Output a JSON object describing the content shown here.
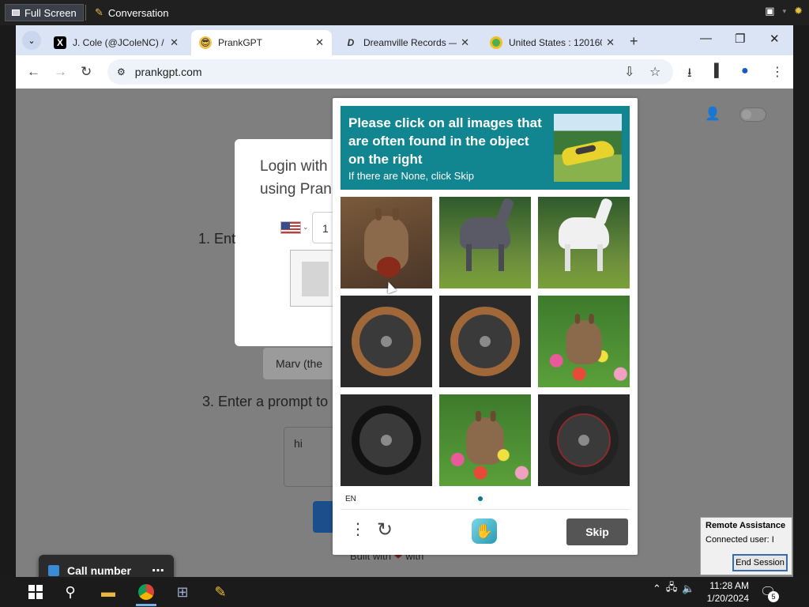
{
  "outer_bar": {
    "full_screen_label": "Full Screen",
    "conversation_label": "Conversation"
  },
  "tabs": [
    {
      "title": "J. Cole (@JColeNC) / X",
      "favicon": "x-logo-icon"
    },
    {
      "title": "PrankGPT",
      "favicon": "sunglasses-emoji-icon",
      "active": true
    },
    {
      "title": "Dreamville Records —",
      "favicon": "dreamville-icon"
    },
    {
      "title": "United States : 120160",
      "favicon": "globe-icon"
    }
  ],
  "address_bar": {
    "url": "prankgpt.com"
  },
  "page": {
    "login_title": "Login with\nusing Pran",
    "phone_prefix": "1",
    "step1": "1. Ent",
    "marv_label": "Marv (the",
    "step3": "3. Enter a prompt to",
    "prompt_value": "hi",
    "built_with": "Built with",
    "built_with_2": "with"
  },
  "captcha": {
    "title": "Please click on all images that are often found in the object on the right",
    "subtitle": "If there are None, click Skip",
    "language": "EN",
    "skip_label": "Skip",
    "tiles": [
      {
        "subject": "squirrel with nut"
      },
      {
        "subject": "grey horse in forest"
      },
      {
        "subject": "white horse in forest"
      },
      {
        "subject": "steering wheel"
      },
      {
        "subject": "steering wheel"
      },
      {
        "subject": "squirrel in flowers"
      },
      {
        "subject": "steering wheel"
      },
      {
        "subject": "squirrel in flowers"
      },
      {
        "subject": "steering wheel"
      }
    ]
  },
  "call_popup": {
    "label": "Call number"
  },
  "remote_assistance": {
    "title": "Remote Assistance",
    "connected": "Connected user: I",
    "end_session": "End Session"
  },
  "taskbar": {
    "time": "11:28 AM",
    "date": "1/20/2024",
    "notification_count": "5"
  }
}
